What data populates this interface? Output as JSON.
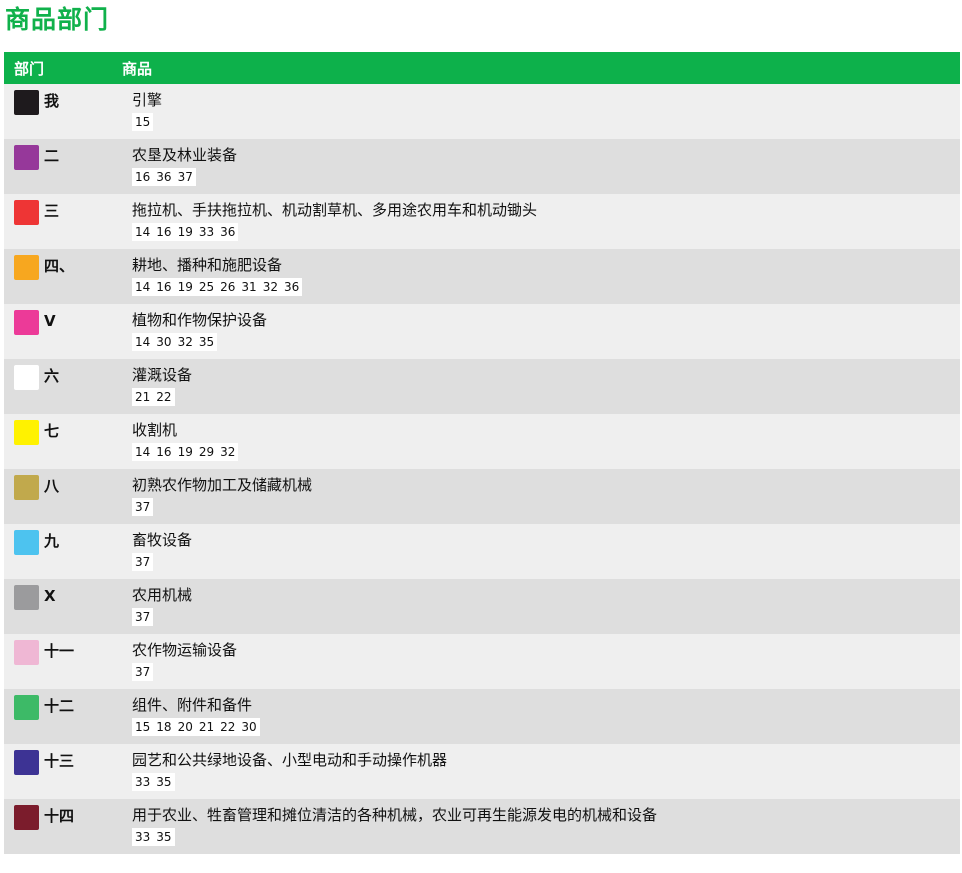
{
  "title": "商品部门",
  "table": {
    "headers": {
      "department": "部门",
      "goods": "商品"
    },
    "rows": [
      {
        "dept": "我",
        "color": "#1e1a1d",
        "goods": "引擎",
        "codes": [
          "15"
        ]
      },
      {
        "dept": "二",
        "color": "#96389a",
        "goods": "农垦及林业装备",
        "codes": [
          "16",
          "36",
          "37"
        ]
      },
      {
        "dept": "三",
        "color": "#ee3535",
        "goods": "拖拉机、手扶拖拉机、机动割草机、多用途农用车和机动锄头",
        "codes": [
          "14",
          "16",
          "19",
          "33",
          "36"
        ]
      },
      {
        "dept": "四、",
        "color": "#f7a71f",
        "goods": "耕地、播种和施肥设备",
        "codes": [
          "14",
          "16",
          "19",
          "25",
          "26",
          "31",
          "32",
          "36"
        ]
      },
      {
        "dept": "V",
        "color": "#ec3a98",
        "goods": "植物和作物保护设备",
        "codes": [
          "14",
          "30",
          "32",
          "35"
        ]
      },
      {
        "dept": "六",
        "color": "#ffffff",
        "goods": "灌溉设备",
        "codes": [
          "21",
          "22"
        ]
      },
      {
        "dept": "七",
        "color": "#fff200",
        "goods": "收割机",
        "codes": [
          "14",
          "16",
          "19",
          "29",
          "32"
        ]
      },
      {
        "dept": "八",
        "color": "#c1a94c",
        "goods": "初熟农作物加工及储藏机械",
        "codes": [
          "37"
        ]
      },
      {
        "dept": "九",
        "color": "#4dc3ef",
        "goods": "畜牧设备",
        "codes": [
          "37"
        ]
      },
      {
        "dept": "X",
        "color": "#9b9b9d",
        "goods": "农用机械",
        "codes": [
          "37"
        ]
      },
      {
        "dept": "十一",
        "color": "#efb7d4",
        "goods": "农作物运输设备",
        "codes": [
          "37"
        ]
      },
      {
        "dept": "十二",
        "color": "#3dba67",
        "goods": "组件、附件和备件",
        "codes": [
          "15",
          "18",
          "20",
          "21",
          "22",
          "30"
        ]
      },
      {
        "dept": "十三",
        "color": "#3d3394",
        "goods": "园艺和公共绿地设备、小型电动和手动操作机器",
        "codes": [
          "33",
          "35"
        ]
      },
      {
        "dept": "十四",
        "color": "#7b1c2c",
        "goods": "用于农业、牲畜管理和摊位清洁的各种机械，农业可再生能源发电的机械和设备",
        "codes": [
          "33",
          "35"
        ]
      }
    ]
  }
}
